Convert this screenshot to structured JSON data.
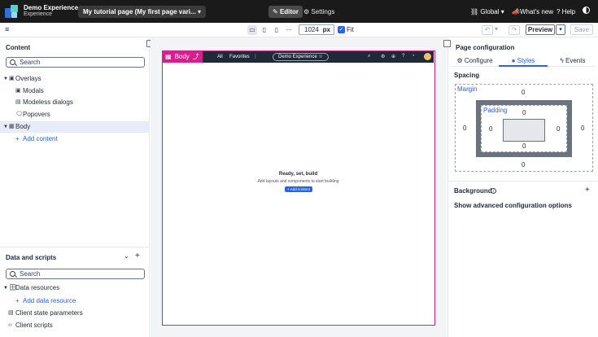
{
  "topbar": {
    "app_title": "Demo Experience",
    "app_subtitle": "Experience",
    "page_selector": "My tutorial page (My first page vari...",
    "editor_label": "Editor",
    "settings_label": "Settings",
    "global_label": "Global",
    "whats_new_label": "What's new",
    "help_label": "Help"
  },
  "toolbar": {
    "canvas_width": "1024",
    "width_unit": "px",
    "fit_label": "Fit",
    "preview_label": "Preview",
    "save_label": "Save"
  },
  "content_panel": {
    "title": "Content",
    "search_placeholder": "Search",
    "items": [
      {
        "label": "Overlays"
      },
      {
        "label": "Modals"
      },
      {
        "label": "Modeless dialogs"
      },
      {
        "label": "Popovers"
      },
      {
        "label": "Body"
      },
      {
        "label": "Add content"
      }
    ]
  },
  "data_panel": {
    "title": "Data and scripts",
    "search_placeholder": "Search",
    "items": [
      {
        "label": "Data resources"
      },
      {
        "label": "Add data resource"
      },
      {
        "label": "Client state parameters"
      },
      {
        "label": "Client scripts"
      }
    ]
  },
  "canvas": {
    "body_tag": "Body",
    "nav_all": "All",
    "nav_favorites": "Favorites",
    "experience_pill": "Demo Experience ☆",
    "empty_title": "Ready, set, build",
    "empty_subtitle": "Add layouts and components to start building",
    "empty_button": "+ Add content"
  },
  "config_panel": {
    "title": "Page configuration",
    "tabs": [
      {
        "label": "Configure"
      },
      {
        "label": "Styles"
      },
      {
        "label": "Events"
      }
    ],
    "spacing_label": "Spacing",
    "margin_label": "Margin",
    "padding_label": "Padding",
    "margin": {
      "top": "0",
      "right": "0",
      "bottom": "0",
      "left": "0"
    },
    "padding": {
      "top": "0",
      "right": "0",
      "bottom": "0",
      "left": "0"
    },
    "background_label": "Background",
    "advanced_label": "Show advanced configuration options"
  },
  "colors": {
    "accent": "#2563eb",
    "selection": "#d61f8c",
    "topbar": "#1a1a1a"
  }
}
